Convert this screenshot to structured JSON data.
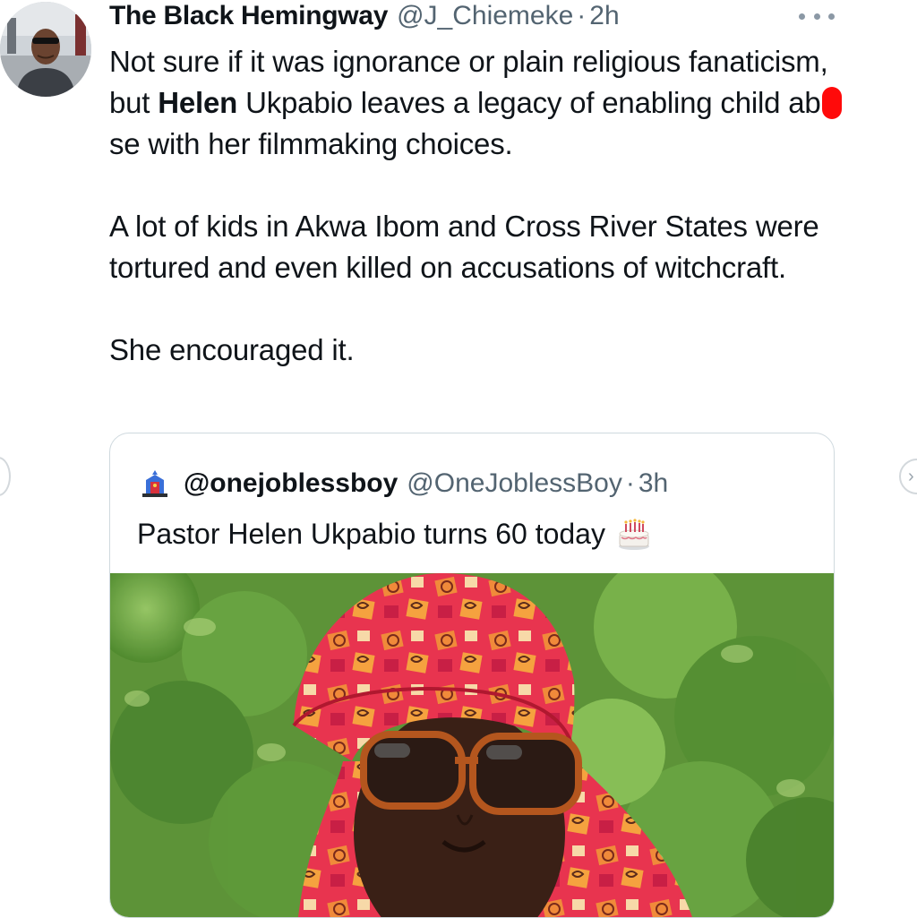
{
  "tweet": {
    "author_name": "The Black Hemingway",
    "author_handle": "@J_Chiemeke",
    "separator": "·",
    "time": "2h",
    "body": {
      "p1_a": "Not sure if it was ignorance or plain religious fanaticism, but ",
      "p1_bold": "Helen",
      "p1_b": " Ukpabio leaves a legacy of enabling child ab",
      "p1_c": "se with her filmmaking choices.",
      "p2": "A lot of kids in Akwa Ibom and Cross River States were tortured and even killed on accusations of witchcraft.",
      "p3": "She encouraged it."
    },
    "more_icon": "more-horizontal-icon"
  },
  "quote": {
    "author_name": "@onejoblessboy",
    "author_handle": "@OneJoblessBoy",
    "separator": "·",
    "time": "3h",
    "text": "Pastor Helen Ukpabio turns 60 today",
    "emoji_icon": "birthday-cake-icon"
  },
  "colors": {
    "text_primary": "#0f1419",
    "text_secondary": "#536471",
    "border": "#cfd9de",
    "redaction": "#ff0a0a"
  }
}
